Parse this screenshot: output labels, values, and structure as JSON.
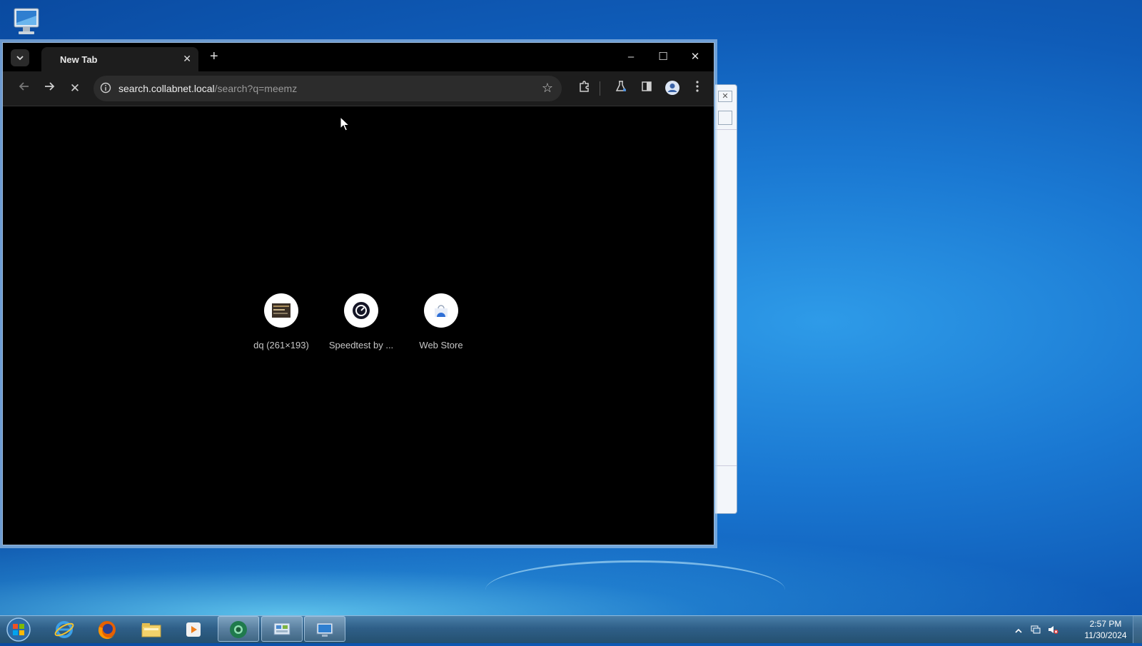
{
  "browser": {
    "tab_title": "New Tab",
    "tab_close": "✕",
    "new_tab": "+",
    "minimize": "–",
    "maximize": "☐",
    "close": "✕",
    "url_host": "search.collabnet.local",
    "url_path": "/search?q=meemz",
    "star": "☆",
    "loading_stop": "✕"
  },
  "shortcuts": [
    {
      "label": "dq (261×193)",
      "icon": "image-thumbnail-icon"
    },
    {
      "label": "Speedtest by ...",
      "icon": "speedometer-icon"
    },
    {
      "label": "Web Store",
      "icon": "web-store-icon"
    }
  ],
  "taskbar": {
    "time": "2:57 PM",
    "date": "11/30/2024",
    "apps": [
      "internet-explorer-icon",
      "firefox-icon",
      "file-explorer-icon",
      "media-player-icon",
      "chrome-icon",
      "control-panel-icon",
      "remote-desktop-icon"
    ]
  },
  "colors": {
    "desktop": "#1a78d2",
    "browser_frame": "#000000",
    "toolbar": "#1d1d1d",
    "omnibox": "#2c2c2c"
  }
}
